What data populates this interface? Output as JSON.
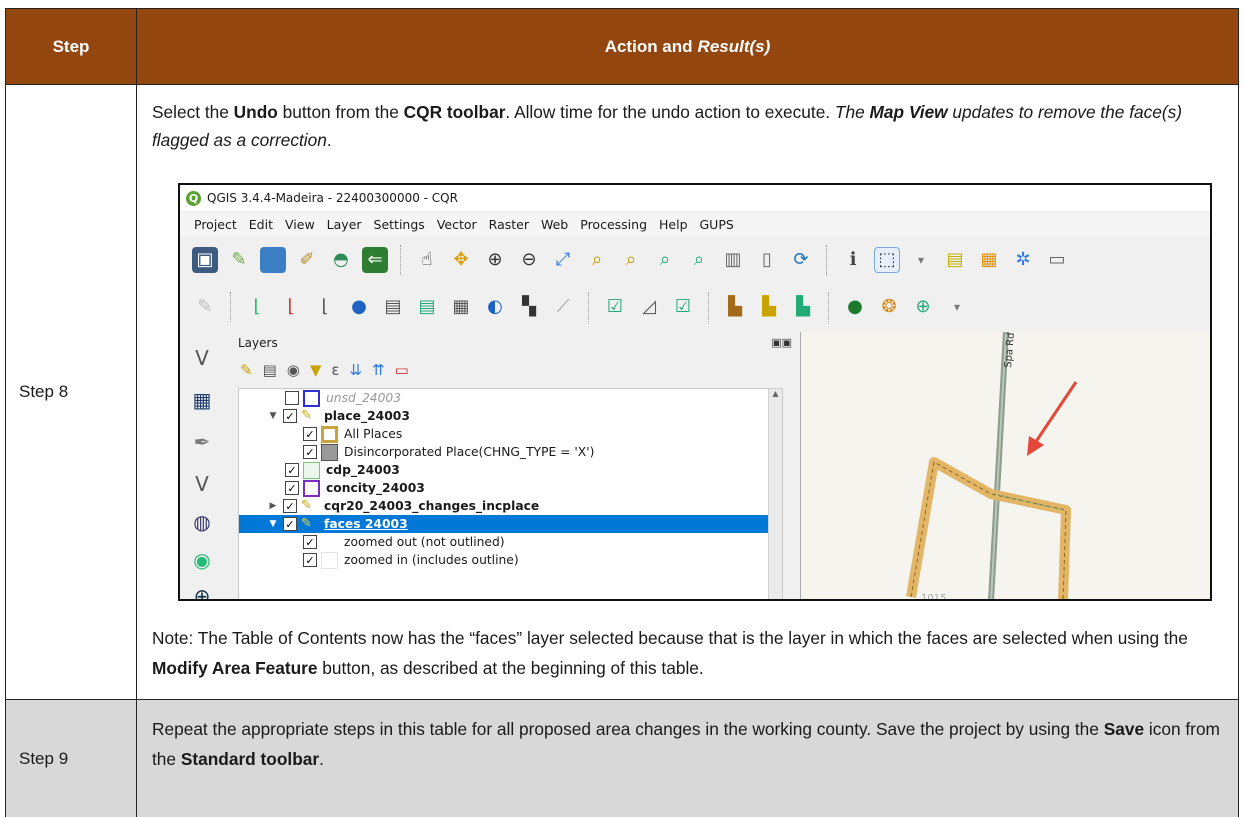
{
  "header": {
    "step": "Step",
    "action_plain": "Action and",
    "action_italic": "Result(s)"
  },
  "row1": {
    "step": "Step 8",
    "para1": {
      "a": "Select the ",
      "b": "Undo",
      "c": " button from the ",
      "d": "CQR toolbar",
      "e": ". Allow time for the undo action to execute. ",
      "f": "The ",
      "g": "Map View",
      "h": " updates to remove the face(s) flagged as a correction",
      ".": "."
    },
    "note": {
      "a": "Note: The Table of Contents now has the “faces” layer selected because that is the layer in which the faces are selected when using the ",
      "b": "Modify Area Feature",
      "c": " button, as described at the beginning of this table."
    }
  },
  "row2": {
    "step": "Step 9",
    "text": {
      "a": "Repeat the appropriate steps in this table for all proposed area changes in the working county. Save the project by using the ",
      "b": "Save",
      "c": " icon from the ",
      "d": "Standard toolbar",
      "e": "."
    }
  },
  "qgis": {
    "title": "QGIS 3.4.4-Madeira - 22400300000 - CQR",
    "menu": [
      "Project",
      "Edit",
      "View",
      "Layer",
      "Settings",
      "Vector",
      "Raster",
      "Web",
      "Processing",
      "Help",
      "GUPS"
    ],
    "layers_title": "Layers",
    "layers": [
      {
        "name": "unsd_24003",
        "checked": false,
        "style": "italic"
      },
      {
        "name": "place_24003",
        "checked": true,
        "style": "bold"
      },
      {
        "name": "All Places",
        "checked": true,
        "style": "normal"
      },
      {
        "name": "Disincorporated Place(CHNG_TYPE = 'X')",
        "checked": true,
        "style": "normal"
      },
      {
        "name": "cdp_24003",
        "checked": true,
        "style": "bold"
      },
      {
        "name": "concity_24003",
        "checked": true,
        "style": "bold"
      },
      {
        "name": "cqr20_24003_changes_incplace",
        "checked": true,
        "style": "bold"
      },
      {
        "name": "faces 24003",
        "checked": true,
        "style": "selected"
      },
      {
        "name": "zoomed out (not outlined)",
        "checked": true,
        "style": "normal"
      },
      {
        "name": "zoomed in (includes outline)",
        "checked": true,
        "style": "normal"
      }
    ],
    "map_road_label": "Spa Rd",
    "map_partial_label": "1015"
  },
  "colors": {
    "header_bg": "#94460f",
    "row2_bg": "#d8d8d8",
    "selection": "#0078d7",
    "place_outline": "#e3b567"
  }
}
